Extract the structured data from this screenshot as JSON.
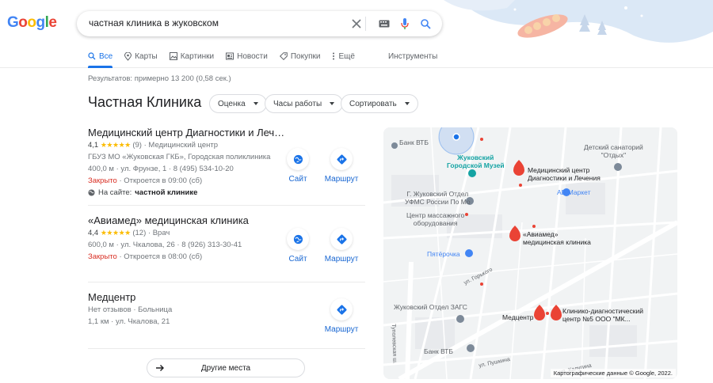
{
  "search": {
    "query": "частная клиника в жуковском"
  },
  "logo": {
    "letters": [
      "G",
      "o",
      "g",
      "l",
      "e"
    ]
  },
  "tabs": [
    {
      "label": "Все",
      "icon": "search-icon",
      "active": true
    },
    {
      "label": "Карты",
      "icon": "map-pin-icon",
      "active": false
    },
    {
      "label": "Картинки",
      "icon": "image-icon",
      "active": false
    },
    {
      "label": "Новости",
      "icon": "news-icon",
      "active": false
    },
    {
      "label": "Покупки",
      "icon": "tag-icon",
      "active": false
    },
    {
      "label": "Ещё",
      "icon": "more-vert-icon",
      "active": false
    }
  ],
  "tools_label": "Инструменты",
  "results_count": "Результатов: примерно 13 200 (0,58 сек.)",
  "local_pack": {
    "title": "Частная Клиника",
    "filters": [
      "Оценка",
      "Часы работы",
      "Сортировать"
    ],
    "places": [
      {
        "name": "Медицинский центр Диагностики и Леч…",
        "rating": "4,1",
        "stars": "★★★★★",
        "reviews": "(9)",
        "category": "Медицинский центр",
        "line2": "ГБУЗ МО «Жуковская ГКБ», Городская поликлиника",
        "distance": "400,0 м",
        "address": "ул. Фрунзе, 1",
        "phone": "8 (495) 534-10-20",
        "status": "Закрыто",
        "opens": "Откроется в 09:00 (сб)",
        "site_prefix": "На сайте:",
        "site_match": "частной клинике",
        "actions": [
          "Сайт",
          "Маршрут"
        ]
      },
      {
        "name": "«Авиамед» медицинская клиника",
        "rating": "4,4",
        "stars": "★★★★★",
        "reviews": "(12)",
        "category": "Врач",
        "distance": "600,0 м",
        "address": "ул. Чкалова, 26",
        "phone": "8 (926) 313-30-41",
        "status": "Закрыто",
        "opens": "Откроется в 08:00 (сб)",
        "actions": [
          "Сайт",
          "Маршрут"
        ]
      },
      {
        "name": "Медцентр",
        "reviews_text": "Нет отзывов",
        "category": "Больница",
        "distance": "1,1 км",
        "address": "ул. Чкалова, 21",
        "actions": [
          "Маршрут"
        ]
      }
    ],
    "more_label": "Другие места"
  },
  "map": {
    "credit": "Картографические данные © Google, 2022.",
    "labels": {
      "bank_vtb_top": "Банк ВТБ",
      "museum": "Жуковский\nГородской Музей",
      "sanatorium": "Детский санаторий\n\"Отдых\"",
      "clinic1": "Медицинский центр\nДиагностики и Лечения",
      "ufms": "Г. Жуковский Отдел\nУФМС России По Мо",
      "ab_market": "АВ Маркет",
      "massage": "Центр массажного\nоборудования",
      "aviamed": "«Авиамед»\nмедицинская клиника",
      "pyaterochka": "Пятёрочка",
      "zags": "Жуковский Отдел ЗАГС",
      "medcenter": "Медцентр",
      "clinic5": "Клинико-диагностический\nцентр №5 ООО \"МК...",
      "bank_vtb_bottom": "Банк ВТБ",
      "street_gorkogo": "ул. Горького",
      "street_turpolevskaya": "Туполевская ш.",
      "street_pushkina": "ул. Пушкина",
      "street_kalugina": "ул. Калугина"
    }
  },
  "colors": {
    "accent": "#1a73e8",
    "closed": "#d93025",
    "star": "#fbbc04",
    "link": "#1967d2",
    "marker": "#ea4335"
  }
}
